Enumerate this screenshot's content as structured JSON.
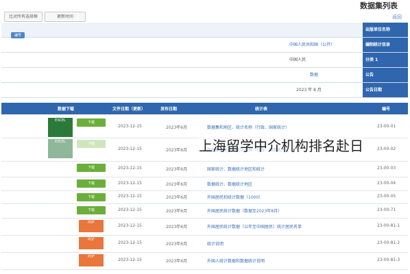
{
  "page_title": "数据集列表",
  "back": "返回",
  "top_buttons": [
    "更新时间",
    "比对所有选择框"
  ],
  "info": [
    {
      "label": "出版单位名称",
      "value": "国家统计局（行政执行单位）"
    },
    {
      "label": "编制统计目录",
      "value": "中国人民共和国（公开）",
      "link": true
    },
    {
      "label": "分类 1",
      "value": "中国人民"
    },
    {
      "label": "公告",
      "value": "数据"
    },
    {
      "label": "公告日期",
      "value": "2023 年 8 月"
    }
  ],
  "blue_button": "编号",
  "columns": [
    "编号",
    "统计表",
    "发布日期",
    "文件日期（更新）",
    "数据下载"
  ],
  "rows": [
    {
      "code": "23-00-01",
      "name": "数据集和地区、统计名称（行政、国家统计）",
      "date": "2023年6月",
      "upd": "2023-12-15",
      "btn": "下载",
      "file": "EXCEL"
    },
    {
      "code": "23-00-02",
      "name": "数据集和地区、统计名称（行政、国家统计）",
      "date": "2023年6月",
      "upd": "2023-12-15",
      "btn": "下载",
      "file": "EXCEL"
    },
    {
      "code": "23-00-03",
      "name": "国家统计、数据统计地区和统计",
      "date": "2023年6月",
      "upd": "2023-12-15",
      "btn": "下载"
    },
    {
      "code": "23-00-04",
      "name": "数据统计、数据统计地区",
      "date": "2023年6月",
      "upd": "2023-12-15",
      "btn": "下载"
    },
    {
      "code": "23-00-05",
      "name": "外国居民和统计数据（1000）",
      "date": "2023年6月",
      "upd": "2023-12-15",
      "btn": "下载"
    },
    {
      "code": "23-00-71",
      "name": "外国居民统计数据（数据至2023年8月）",
      "date": "2023年6月",
      "upd": "2023-12-15",
      "btn": "下载"
    },
    {
      "code": "23-00-81-1",
      "name": "外国居民统计数据（以年至中国居民）统计居民名单",
      "date": "2023年6月",
      "upd": "2023-12-15",
      "btn": "PDF",
      "file": "PDF"
    },
    {
      "code": "23-00-81-2",
      "name": "统计说明",
      "date": "2023年6月",
      "upd": "2023-12-15",
      "btn": "PDF",
      "file": "PDF"
    },
    {
      "code": "23-00-81-3",
      "name": "外国人统计数据和数据统计说明",
      "date": "2023年6月",
      "upd": "2023-12-15",
      "btn": "PDF",
      "file": "PDF"
    }
  ],
  "overlay_text": "上海留学中介机构排名赴日"
}
